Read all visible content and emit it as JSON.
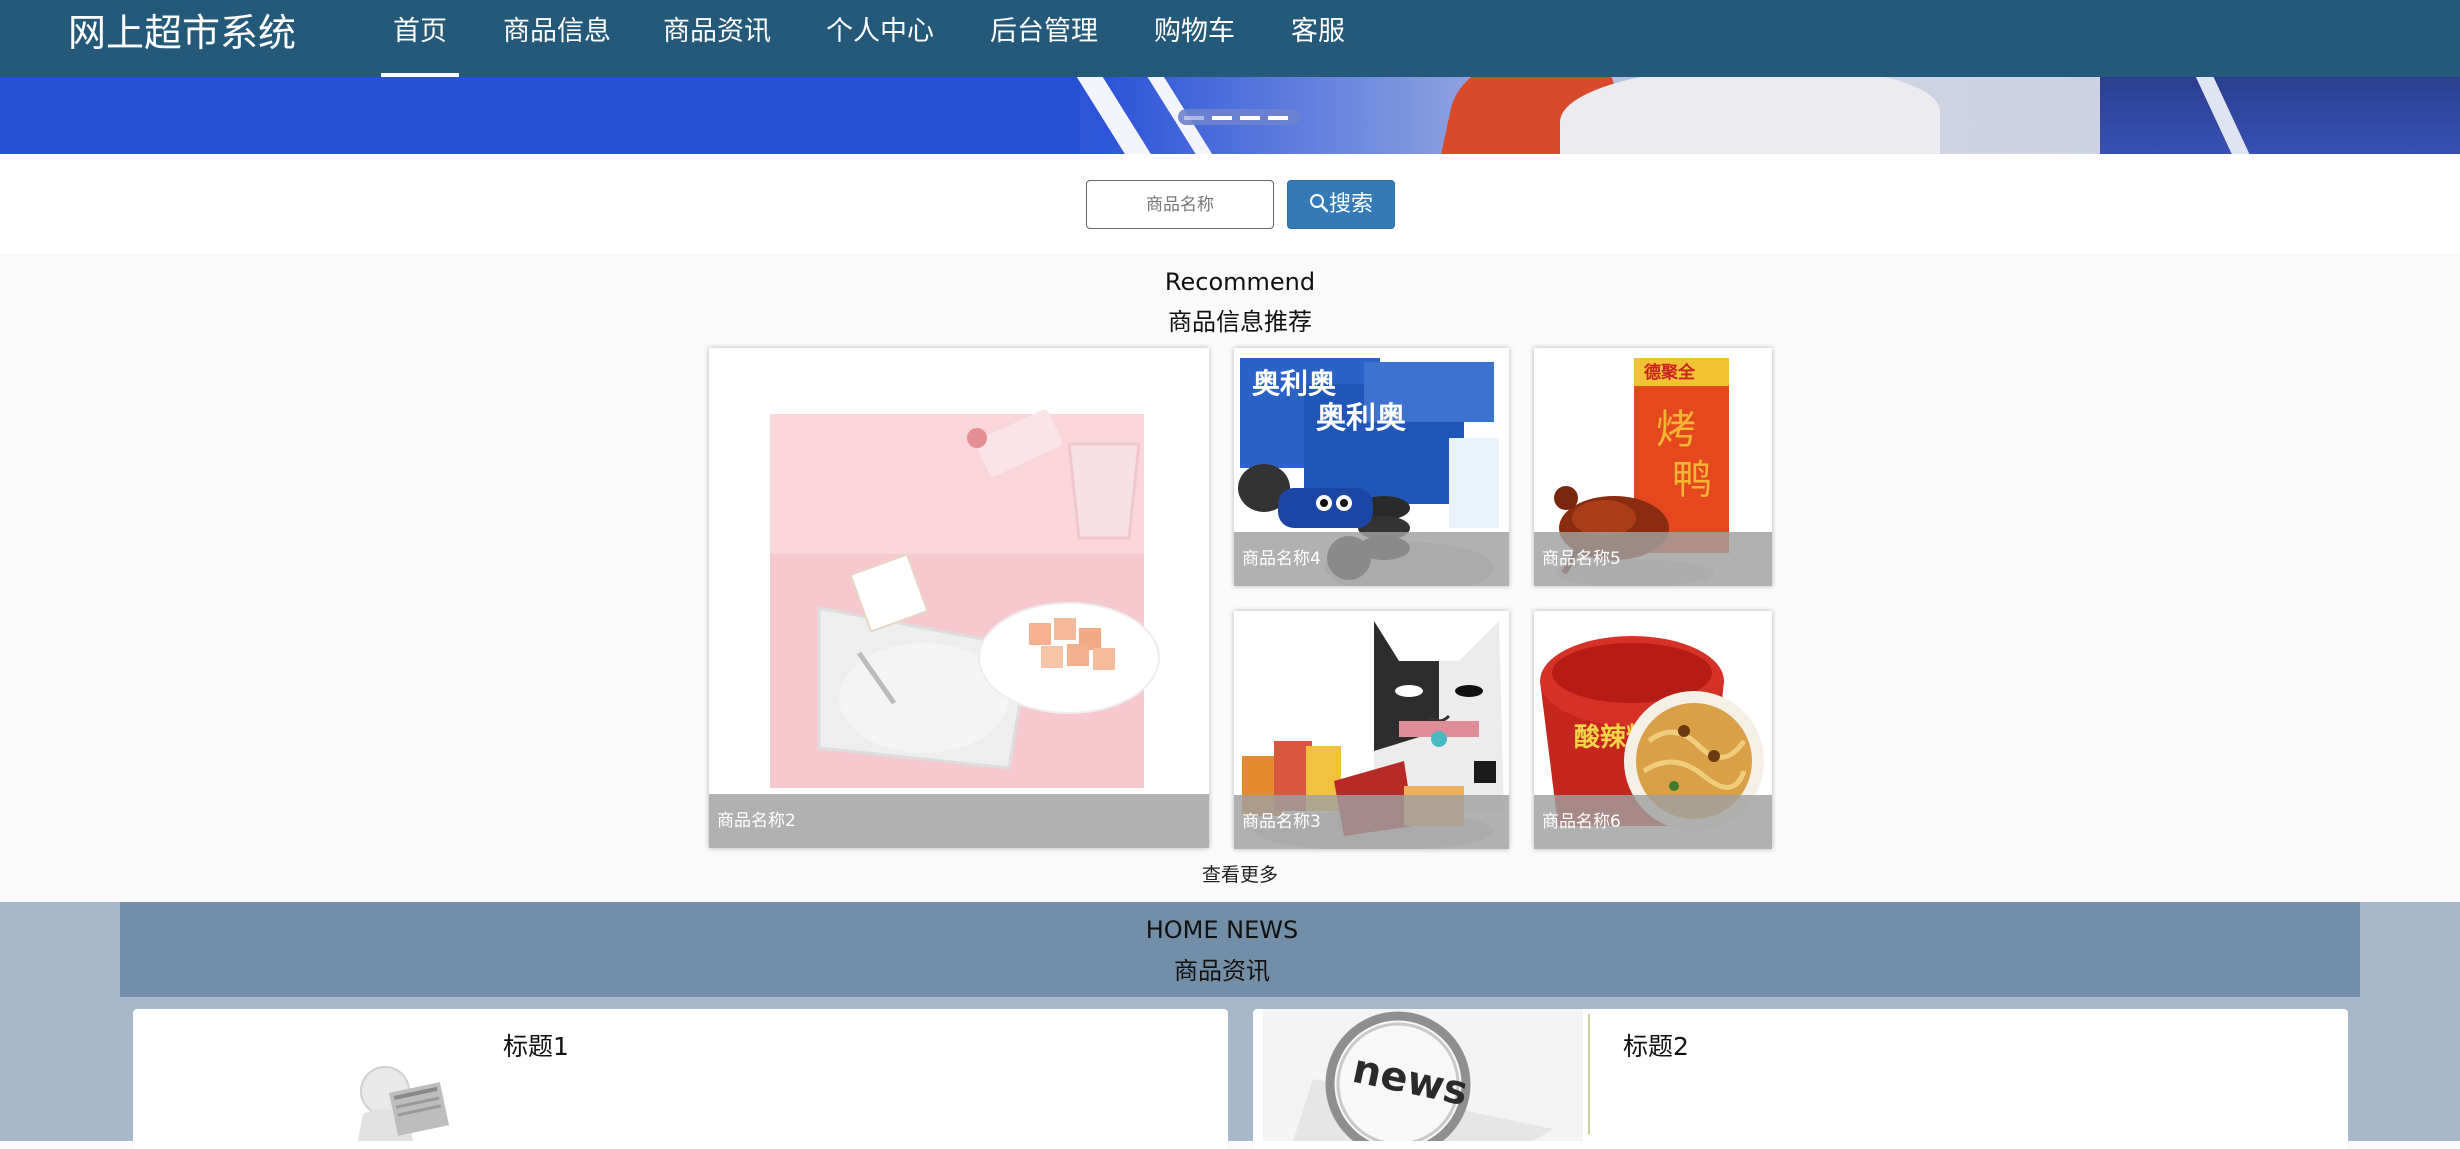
{
  "nav": {
    "brand": "网上超市系统",
    "items": [
      "首页",
      "商品信息",
      "商品资讯",
      "个人中心",
      "后台管理",
      "购物车",
      "客服"
    ],
    "active_index": 0
  },
  "search": {
    "placeholder": "商品名称",
    "button_label": "搜索"
  },
  "recommend": {
    "title_en": "Recommend",
    "title_cn": "商品信息推荐",
    "products": [
      "商品名称2",
      "商品名称4",
      "商品名称5",
      "商品名称3",
      "商品名称6"
    ],
    "more_label": "查看更多"
  },
  "news": {
    "title_en": "HOME NEWS",
    "title_cn": "商品资讯",
    "items": [
      "标题1",
      "标题2"
    ]
  },
  "colors": {
    "nav_bg": "#25597a",
    "search_button": "#337ab7",
    "news_header_bg": "#738fa8",
    "news_section_bg": "#a7b8cb"
  }
}
